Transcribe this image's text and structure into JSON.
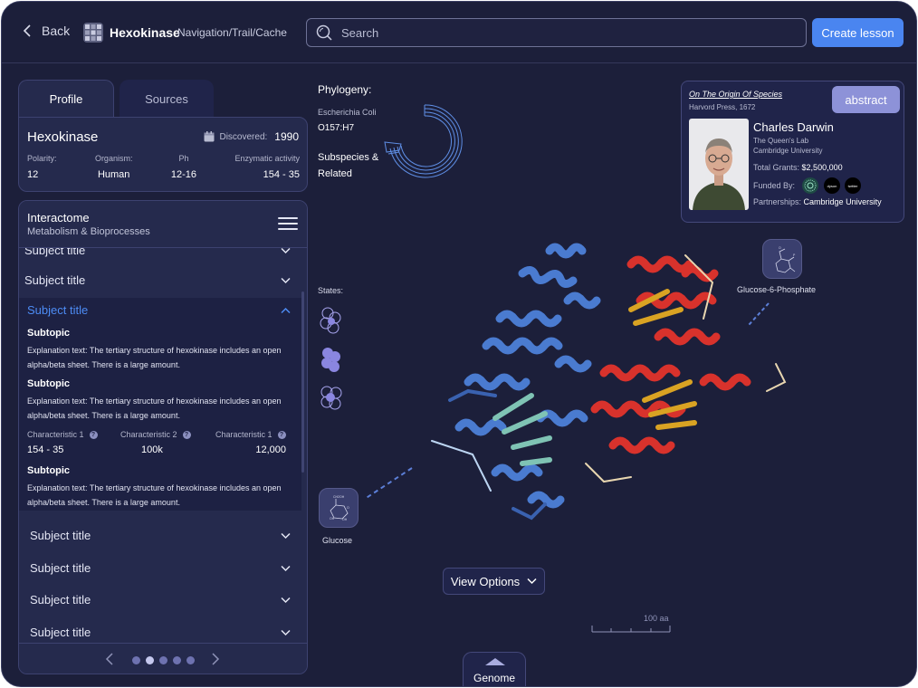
{
  "header": {
    "back_label": "Back",
    "app_title": "Hexokinase",
    "breadcrumb": "Navigation/Trail/Cache",
    "search_placeholder": "Search",
    "create_label": "Create lesson"
  },
  "tabs": [
    {
      "label": "Profile",
      "active": true
    },
    {
      "label": "Sources",
      "active": false
    }
  ],
  "profile": {
    "name": "Hexokinase",
    "discovered_label": "Discovered:",
    "discovered_year": "1990",
    "stats": [
      {
        "label": "Polarity:",
        "value": "12"
      },
      {
        "label": "Organism:",
        "value": "Human"
      },
      {
        "label": "Ph",
        "value": "12-16"
      },
      {
        "label": "Enzymatic activity",
        "value": "154 - 35"
      }
    ]
  },
  "interactome": {
    "title": "Interactome",
    "subtitle": "Metabolism & Bioprocesses",
    "top_rows": [
      "Subject title",
      "Subject title"
    ],
    "expanded": {
      "title": "Subject title",
      "subtopics": [
        {
          "title": "Subtopic",
          "text": "Explanation text: The tertiary structure of hexokinase includes an open alpha/beta sheet. There is a large amount."
        },
        {
          "title": "Subtopic",
          "text": "Explanation text: The tertiary structure of hexokinase includes an open alpha/beta sheet. There is a large amount."
        },
        {
          "title": "Subtopic",
          "text": "Explanation text: The tertiary structure of hexokinase includes an open alpha/beta sheet. There is a large amount."
        }
      ],
      "characteristics": [
        {
          "label": "Characteristic 1",
          "value": "154 - 35"
        },
        {
          "label": "Characteristic 2",
          "value": "100k"
        },
        {
          "label": "Characteristic 1",
          "value": "12,000"
        }
      ]
    },
    "bottom_rows": [
      "Subject title",
      "Subject title",
      "Subject title",
      "Subject title"
    ],
    "pager": {
      "pages": 5,
      "active": 1
    }
  },
  "phylogeny": {
    "label": "Phylogeny:",
    "organism": "Escherichia Coli",
    "strain": "O157:H7",
    "subspecies": "Subspecies & Related"
  },
  "states_label": "States:",
  "molecules": {
    "glucose": "Glucose",
    "g6p": "Glucose-6-Phosphate"
  },
  "view_options_label": "View Options",
  "scale_label": "100 aa",
  "genome_label": "Genome",
  "citation": {
    "title": "On The Origin Of Species",
    "publisher": "Harvord Press, 1672",
    "abstract_label": "abstract",
    "author": "Charles Darwin",
    "affiliation_1": "The Queen's Lab",
    "affiliation_2": "Cambridge University",
    "grants_label": "Total Grants:",
    "grants_value": "$2,500,000",
    "funded_label": "Funded By:",
    "funders": [
      "dyson",
      "twitter"
    ],
    "partnerships_label": "Partnerships:",
    "partnerships_value": "Cambridge University"
  },
  "colors": {
    "background": "#1c1f3a",
    "panel": "#252a4d",
    "accent": "#4a85f0",
    "abstract_button": "#8d92d8",
    "helix_blue": "#4a7bd0",
    "helix_red": "#d8322c",
    "sheet_gold": "#d9a323",
    "sheet_teal": "#7fc3b4"
  },
  "icons": [
    "chevron-left-icon",
    "grid-logo-icon",
    "search-icon",
    "hamburger-icon",
    "chevron-down-icon",
    "chevron-up-icon",
    "calendar-icon",
    "question-icon",
    "chevron-right-icon"
  ]
}
